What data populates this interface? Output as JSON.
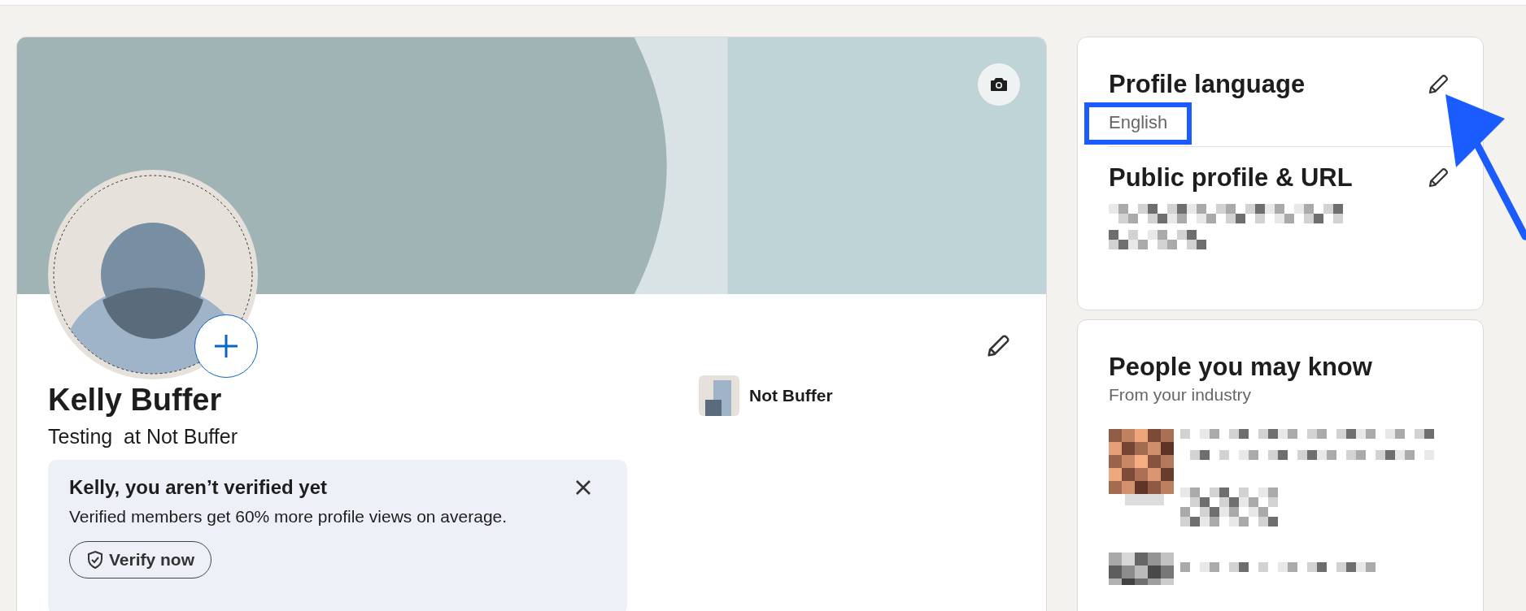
{
  "profile_card": {
    "name": "Kelly Buffer",
    "headline": "Testing  at Not Buffer",
    "company": "Not Buffer",
    "verification": {
      "title": "Kelly, you aren’t verified yet",
      "text": "Verified members get 60% more profile views on average.",
      "button": "Verify now"
    }
  },
  "sidebar": {
    "settings": [
      {
        "title": "Profile language",
        "value": "English",
        "annotated": true
      },
      {
        "title": "Public profile & URL",
        "annotated": false
      }
    ],
    "people": {
      "title": "People you may know",
      "subtitle": "From your industry"
    }
  }
}
